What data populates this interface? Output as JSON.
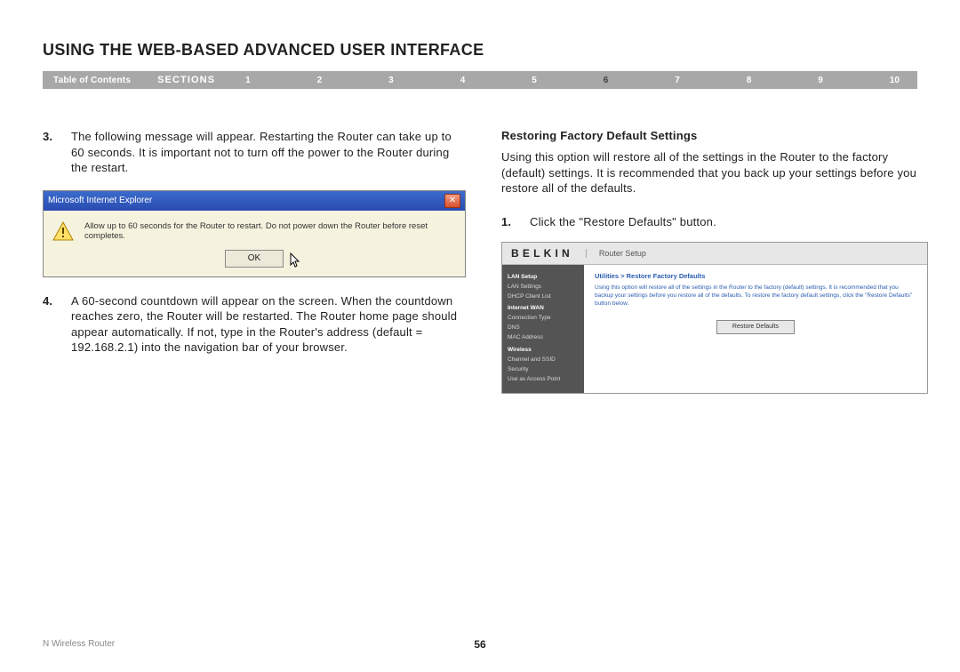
{
  "title": "USING THE WEB-BASED ADVANCED USER INTERFACE",
  "nav": {
    "toc": "Table of Contents",
    "sections": "SECTIONS",
    "items": [
      "1",
      "2",
      "3",
      "4",
      "5",
      "6",
      "7",
      "8",
      "9",
      "10"
    ],
    "active": "6"
  },
  "left": {
    "step3": {
      "num": "3.",
      "text": "The following message will appear. Restarting the Router can take up to 60 seconds. It is important not to turn off the power to the Router during the restart."
    },
    "dialog": {
      "title": "Microsoft Internet Explorer",
      "message": "Allow up to 60 seconds for the Router to restart. Do not power down the Router before reset completes.",
      "ok": "OK"
    },
    "step4": {
      "num": "4.",
      "text": "A 60-second countdown will appear on the screen. When the countdown reaches zero, the Router will be restarted. The Router home page should appear automatically. If not, type in the Router's address (default = 192.168.2.1) into the navigation bar of your browser."
    }
  },
  "right": {
    "heading": "Restoring Factory Default Settings",
    "intro": "Using this option will restore all of the settings in the Router to the factory (default) settings. It is recommended that you back up your settings before you restore all of the defaults.",
    "step1": {
      "num": "1.",
      "text": "Click the \"Restore Defaults\" button."
    },
    "belkin": {
      "logo": "BELKIN",
      "subtitle": "Router Setup",
      "side": {
        "lan_setup": "LAN Setup",
        "lan_settings": "LAN Settings",
        "dhcp": "DHCP Client List",
        "wan": "Internet WAN",
        "conn": "Connection Type",
        "dns": "DNS",
        "mac": "MAC Address",
        "wireless": "Wireless",
        "chan": "Channel and SSID",
        "security": "Security",
        "ap": "Use as Access Point"
      },
      "crumb": "Utilities > Restore Factory Defaults",
      "body": "Using this option will restore all of the settings in the Router to the factory (default) settings. It is recommended that you backup your settings before you restore all of the defaults. To restore the factory default settings, click the \"Restore Defaults\" button below.",
      "button": "Restore Defaults"
    }
  },
  "footer": {
    "product": "N Wireless Router",
    "page": "56"
  }
}
